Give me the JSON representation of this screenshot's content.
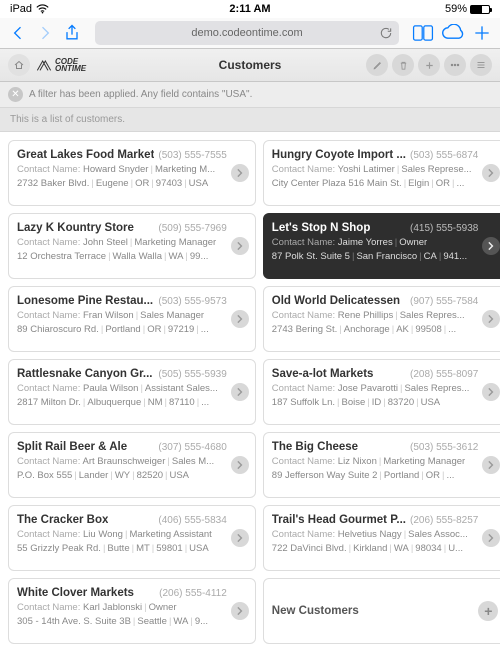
{
  "status": {
    "device": "iPad",
    "time": "2:11 AM",
    "battery_pct": "59%"
  },
  "browser": {
    "address": "demo.codeontime.com"
  },
  "header": {
    "logo_top": "CODE",
    "logo_bottom": "ONTIME",
    "title": "Customers"
  },
  "filter": {
    "text": "A filter has been applied. Any field contains \"USA\"."
  },
  "list": {
    "subhead": "This is a list of customers.",
    "add_label": "New Customers",
    "items": [
      {
        "name": "Great Lakes Food Market",
        "phone": "(503) 555-7555",
        "contact": "Howard Snyder",
        "title": "Marketing M...",
        "addr": "2732 Baker Blvd.",
        "city": "Eugene",
        "region": "OR",
        "postal": "97403",
        "country": "USA",
        "selected": false
      },
      {
        "name": "Hungry Coyote Import ...",
        "phone": "(503) 555-6874",
        "contact": "Yoshi Latimer",
        "title": "Sales Represe...",
        "addr": "City Center Plaza 516 Main St.",
        "city": "Elgin",
        "region": "OR",
        "postal": "",
        "country": "...",
        "selected": false
      },
      {
        "name": "Lazy K Kountry Store",
        "phone": "(509) 555-7969",
        "contact": "John Steel",
        "title": "Marketing Manager",
        "addr": "12 Orchestra Terrace",
        "city": "Walla Walla",
        "region": "WA",
        "postal": "99...",
        "country": "",
        "selected": false
      },
      {
        "name": "Let's Stop N Shop",
        "phone": "(415) 555-5938",
        "contact": "Jaime Yorres",
        "title": "Owner",
        "addr": "87 Polk St. Suite 5",
        "city": "San Francisco",
        "region": "CA",
        "postal": "941...",
        "country": "",
        "selected": true
      },
      {
        "name": "Lonesome Pine Restau...",
        "phone": "(503) 555-9573",
        "contact": "Fran Wilson",
        "title": "Sales Manager",
        "addr": "89 Chiaroscuro Rd.",
        "city": "Portland",
        "region": "OR",
        "postal": "97219",
        "country": "...",
        "selected": false
      },
      {
        "name": "Old World Delicatessen",
        "phone": "(907) 555-7584",
        "contact": "Rene Phillips",
        "title": "Sales Repres...",
        "addr": "2743 Bering St.",
        "city": "Anchorage",
        "region": "AK",
        "postal": "99508",
        "country": "...",
        "selected": false
      },
      {
        "name": "Rattlesnake Canyon Gr...",
        "phone": "(505) 555-5939",
        "contact": "Paula Wilson",
        "title": "Assistant Sales...",
        "addr": "2817 Milton Dr.",
        "city": "Albuquerque",
        "region": "NM",
        "postal": "87110",
        "country": "...",
        "selected": false
      },
      {
        "name": "Save-a-lot Markets",
        "phone": "(208) 555-8097",
        "contact": "Jose Pavarotti",
        "title": "Sales Repres...",
        "addr": "187 Suffolk Ln.",
        "city": "Boise",
        "region": "ID",
        "postal": "83720",
        "country": "USA",
        "selected": false
      },
      {
        "name": "Split Rail Beer & Ale",
        "phone": "(307) 555-4680",
        "contact": "Art Braunschweiger",
        "title": "Sales M...",
        "addr": "P.O. Box 555",
        "city": "Lander",
        "region": "WY",
        "postal": "82520",
        "country": "USA",
        "selected": false
      },
      {
        "name": "The Big Cheese",
        "phone": "(503) 555-3612",
        "contact": "Liz Nixon",
        "title": "Marketing Manager",
        "addr": "89 Jefferson Way Suite 2",
        "city": "Portland",
        "region": "OR",
        "postal": "...",
        "country": "",
        "selected": false
      },
      {
        "name": "The Cracker Box",
        "phone": "(406) 555-5834",
        "contact": "Liu Wong",
        "title": "Marketing Assistant",
        "addr": "55 Grizzly Peak Rd.",
        "city": "Butte",
        "region": "MT",
        "postal": "59801",
        "country": "USA",
        "selected": false
      },
      {
        "name": "Trail's Head Gourmet P...",
        "phone": "(206) 555-8257",
        "contact": "Helvetius Nagy",
        "title": "Sales Assoc...",
        "addr": "722 DaVinci Blvd.",
        "city": "Kirkland",
        "region": "WA",
        "postal": "98034",
        "country": "U...",
        "selected": false
      },
      {
        "name": "White Clover Markets",
        "phone": "(206) 555-4112",
        "contact": "Karl Jablonski",
        "title": "Owner",
        "addr": "305 - 14th Ave. S. Suite 3B",
        "city": "Seattle",
        "region": "WA",
        "postal": "9...",
        "country": "",
        "selected": false
      }
    ]
  }
}
